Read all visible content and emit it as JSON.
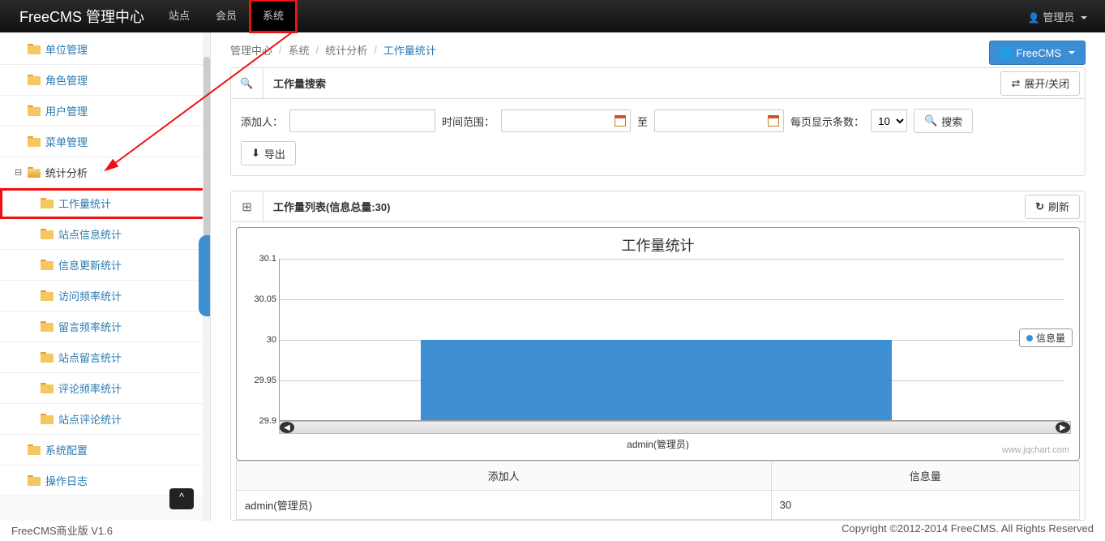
{
  "top_nav": {
    "brand": "FreeCMS 管理中心",
    "items": [
      "站点",
      "会员",
      "系统"
    ],
    "active_index": 2,
    "user_label": "管理员"
  },
  "sidebar": {
    "items": [
      {
        "label": "单位管理",
        "level": 1
      },
      {
        "label": "角色管理",
        "level": 1
      },
      {
        "label": "用户管理",
        "level": 1
      },
      {
        "label": "菜单管理",
        "level": 1
      },
      {
        "label": "统计分析",
        "level": 1,
        "parent": true,
        "expanded": true
      },
      {
        "label": "工作量统计",
        "level": 2,
        "selected": true
      },
      {
        "label": "站点信息统计",
        "level": 2
      },
      {
        "label": "信息更新统计",
        "level": 2
      },
      {
        "label": "访问频率统计",
        "level": 2
      },
      {
        "label": "留言频率统计",
        "level": 2
      },
      {
        "label": "站点留言统计",
        "level": 2
      },
      {
        "label": "评论频率统计",
        "level": 2
      },
      {
        "label": "站点评论统计",
        "level": 2
      },
      {
        "label": "系统配置",
        "level": 1
      },
      {
        "label": "操作日志",
        "level": 1
      }
    ]
  },
  "breadcrumb": {
    "root": "管理中心",
    "parts": [
      "系统",
      "统计分析"
    ],
    "current": "工作量统计"
  },
  "action_button": "FreeCMS",
  "search_panel": {
    "title": "工作量搜索",
    "expand_btn": "展开/关闭",
    "adder_label": "添加人：",
    "time_label": "时间范围：",
    "to_label": "至",
    "per_page_label": "每页显示条数：",
    "per_page_value": "10",
    "search_btn": "搜索",
    "export_btn": "导出"
  },
  "list_panel": {
    "title": "工作量列表(信息总量:30)",
    "refresh_btn": "刷新"
  },
  "chart_data": {
    "type": "bar",
    "title": "工作量统计",
    "categories": [
      "admin(管理员)"
    ],
    "values": [
      30
    ],
    "ylabel": "",
    "ylim": [
      29.9,
      30.1
    ],
    "yticks": [
      29.9,
      29.95,
      30,
      30.05,
      30.1
    ],
    "legend": "信息量",
    "watermark": "www.jqchart.com"
  },
  "table": {
    "columns": [
      "添加人",
      "信息量"
    ],
    "rows": [
      {
        "adder": "admin(管理员)",
        "count": "30"
      }
    ]
  },
  "footer": {
    "left": "FreeCMS商业版 V1.6",
    "right": "Copyright ©2012-2014 FreeCMS. All Rights Reserved"
  }
}
